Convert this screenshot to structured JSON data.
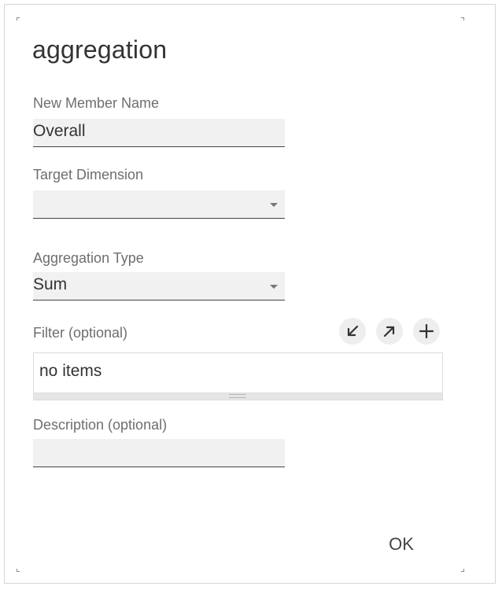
{
  "dialog": {
    "title": "aggregation",
    "new_member_name": {
      "label": "New Member Name",
      "value": "Overall"
    },
    "target_dimension": {
      "label": "Target Dimension",
      "value": ""
    },
    "aggregation_type": {
      "label": "Aggregation Type",
      "value": "Sum"
    },
    "filter": {
      "label": "Filter (optional)",
      "empty_text": "no items",
      "icons": [
        "collapse-icon",
        "expand-icon",
        "add-icon"
      ]
    },
    "description": {
      "label": "Description (optional)",
      "value": ""
    },
    "ok_label": "OK"
  },
  "colors": {
    "field_background": "#f1f1f1",
    "field_underline": "#444444",
    "label_text": "#6e6e6e",
    "icon_button_background": "#eeeeee"
  }
}
